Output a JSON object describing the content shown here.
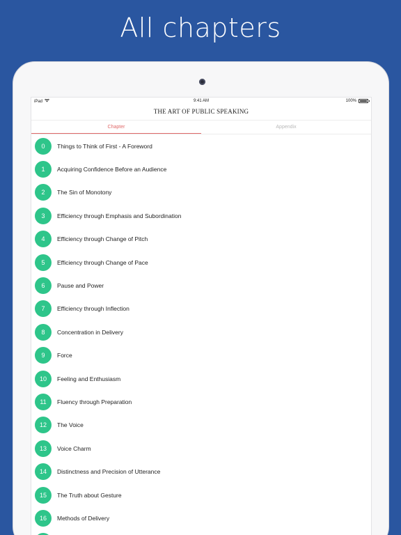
{
  "promo": {
    "heading": "All chapters"
  },
  "status_bar": {
    "carrier": "iPad",
    "time": "9:41 AM",
    "battery": "100%"
  },
  "nav": {
    "title": "THE ART OF PUBLIC SPEAKING"
  },
  "tabs": [
    {
      "label": "Chapter",
      "active": true
    },
    {
      "label": "Appendix",
      "active": false
    }
  ],
  "colors": {
    "background": "#2a56a0",
    "accent_green": "#2ec58a",
    "tab_active": "#e06a6a"
  },
  "chapters": [
    {
      "num": "0",
      "title": "Things to Think of First - A Foreword"
    },
    {
      "num": "1",
      "title": "Acquiring Confidence Before an Audience"
    },
    {
      "num": "2",
      "title": "The Sin of Monotony"
    },
    {
      "num": "3",
      "title": "Efficiency through Emphasis and Subordination"
    },
    {
      "num": "4",
      "title": "Efficiency through Change of Pitch"
    },
    {
      "num": "5",
      "title": "Efficiency through Change of Pace"
    },
    {
      "num": "6",
      "title": "Pause and Power"
    },
    {
      "num": "7",
      "title": "Efficiency through Inflection"
    },
    {
      "num": "8",
      "title": "Concentration in Delivery"
    },
    {
      "num": "9",
      "title": "Force"
    },
    {
      "num": "10",
      "title": "Feeling and Enthusiasm"
    },
    {
      "num": "11",
      "title": "Fluency through Preparation"
    },
    {
      "num": "12",
      "title": "The Voice"
    },
    {
      "num": "13",
      "title": "Voice Charm"
    },
    {
      "num": "14",
      "title": "Distinctness and Precision of Utterance"
    },
    {
      "num": "15",
      "title": "The Truth about Gesture"
    },
    {
      "num": "16",
      "title": "Methods of Delivery"
    }
  ]
}
